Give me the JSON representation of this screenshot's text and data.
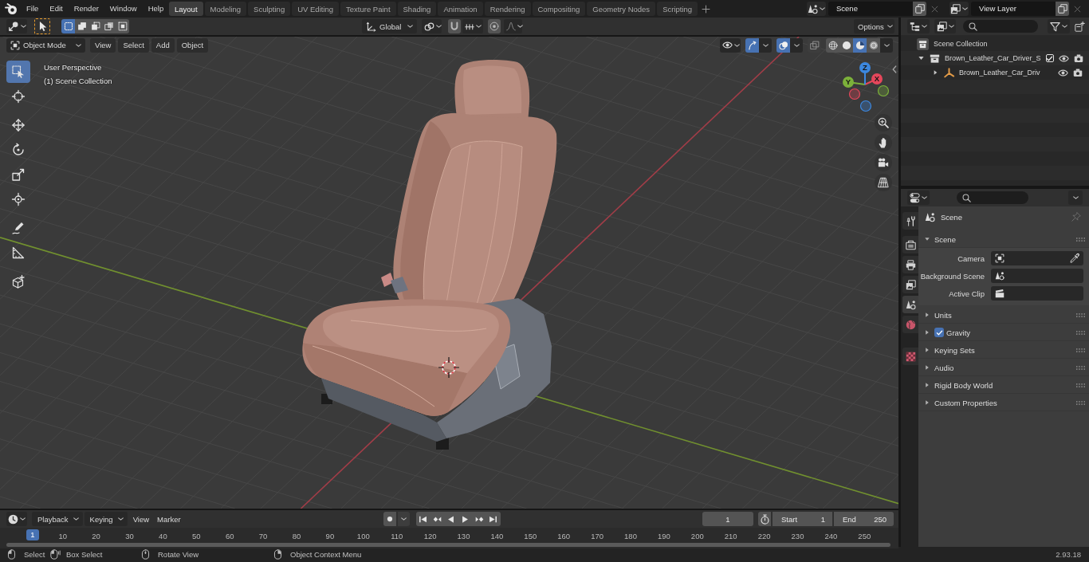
{
  "topbar": {
    "menus": [
      "File",
      "Edit",
      "Render",
      "Window",
      "Help"
    ],
    "workspaces": [
      {
        "label": "Layout",
        "selected": true
      },
      {
        "label": "Modeling",
        "selected": false
      },
      {
        "label": "Sculpting",
        "selected": false
      },
      {
        "label": "UV Editing",
        "selected": false
      },
      {
        "label": "Texture Paint",
        "selected": false
      },
      {
        "label": "Shading",
        "selected": false
      },
      {
        "label": "Animation",
        "selected": false
      },
      {
        "label": "Rendering",
        "selected": false
      },
      {
        "label": "Compositing",
        "selected": false
      },
      {
        "label": "Geometry Nodes",
        "selected": false
      },
      {
        "label": "Scripting",
        "selected": false
      }
    ],
    "scene": "Scene",
    "view_layer": "View Layer"
  },
  "tool_header": {
    "select_modes": [
      {
        "kind": "set",
        "selected": true
      },
      {
        "kind": "extend",
        "selected": false
      },
      {
        "kind": "subtract",
        "selected": false
      },
      {
        "kind": "invert",
        "selected": false
      },
      {
        "kind": "intersect",
        "selected": false
      }
    ],
    "orientation": "Global",
    "options": "Options"
  },
  "viewport": {
    "mode": "Object Mode",
    "menus": [
      "View",
      "Select",
      "Add",
      "Object"
    ],
    "toggles": [
      {
        "kind": "gizmos",
        "on": true
      },
      {
        "kind": "overlays",
        "on": true
      },
      {
        "kind": "xray",
        "on": false
      }
    ],
    "shading": [
      {
        "kind": "wireframe",
        "selected": false
      },
      {
        "kind": "solid",
        "selected": false
      },
      {
        "kind": "material",
        "selected": true
      },
      {
        "kind": "rendered",
        "selected": false
      }
    ],
    "info": [
      "User Perspective",
      "(1) Scene Collection"
    ],
    "tool_groups": [
      [
        {
          "kind": "select-box",
          "selected": true
        },
        {
          "kind": "cursor",
          "selected": false
        }
      ],
      [
        {
          "kind": "move",
          "selected": false
        },
        {
          "kind": "rotate",
          "selected": false
        },
        {
          "kind": "scale",
          "selected": false
        },
        {
          "kind": "transform",
          "selected": false
        }
      ],
      [
        {
          "kind": "annotate",
          "selected": false
        },
        {
          "kind": "measure",
          "selected": false
        }
      ],
      [
        {
          "kind": "add-cube",
          "selected": false
        }
      ]
    ],
    "gizmo_axes": [
      {
        "label": "X",
        "color": "#e5475b"
      },
      {
        "label": "Y",
        "color": "#7cb13a"
      },
      {
        "label": "Z",
        "color": "#3c88e0"
      }
    ]
  },
  "timeline": {
    "menus": [
      {
        "label": "Playback",
        "kind": "dropdown"
      },
      {
        "label": "Keying",
        "kind": "dropdown"
      },
      {
        "label": "View",
        "kind": "menu"
      },
      {
        "label": "Marker",
        "kind": "menu"
      }
    ],
    "current_frame": "1",
    "start": {
      "label": "Start",
      "value": "1"
    },
    "end": {
      "label": "End",
      "value": "250"
    },
    "playhead": "1",
    "ruler": [
      "10",
      "20",
      "30",
      "40",
      "50",
      "60",
      "70",
      "80",
      "90",
      "100",
      "110",
      "120",
      "130",
      "140",
      "150",
      "160",
      "170",
      "180",
      "190",
      "200",
      "210",
      "220",
      "230",
      "240",
      "250"
    ]
  },
  "outliner": {
    "tree": [
      {
        "label": "Scene Collection",
        "kind": "scene-collection",
        "children": [
          {
            "label": "Brown_Leather_Car_Driver_S",
            "kind": "collection",
            "expanded": true,
            "checked": true,
            "children": [
              {
                "label": "Brown_Leather_Car_Driv",
                "kind": "object",
                "expanded": false
              }
            ]
          }
        ]
      }
    ]
  },
  "properties": {
    "tab_groups": [
      [
        {
          "kind": "tool",
          "selected": false
        }
      ],
      [
        {
          "kind": "render",
          "selected": false
        },
        {
          "kind": "output",
          "selected": false
        },
        {
          "kind": "view-layer",
          "selected": false
        },
        {
          "kind": "scene",
          "selected": true
        },
        {
          "kind": "world",
          "selected": false
        }
      ],
      [
        {
          "kind": "texture",
          "selected": false
        }
      ]
    ],
    "context": "Scene",
    "panels": [
      {
        "title": "Scene",
        "expanded": true,
        "fields": [
          {
            "label": "Camera",
            "kind": "object"
          },
          {
            "label": "Background Scene",
            "kind": "scene"
          },
          {
            "label": "Active Clip",
            "kind": "clip"
          }
        ]
      },
      {
        "title": "Units",
        "expanded": false
      },
      {
        "title": "Gravity",
        "expanded": false,
        "checked": true
      },
      {
        "title": "Keying Sets",
        "expanded": false
      },
      {
        "title": "Audio",
        "expanded": false
      },
      {
        "title": "Rigid Body World",
        "expanded": false
      },
      {
        "title": "Custom Properties",
        "expanded": false
      }
    ]
  },
  "status_bar": {
    "hints": [
      {
        "kind": "left",
        "label": "Select"
      },
      {
        "kind": "drag",
        "label": "Box Select"
      },
      {
        "kind": "middle",
        "label": "Rotate View"
      },
      {
        "kind": "right",
        "label": "Object Context Menu"
      }
    ],
    "version": "2.93.18"
  }
}
